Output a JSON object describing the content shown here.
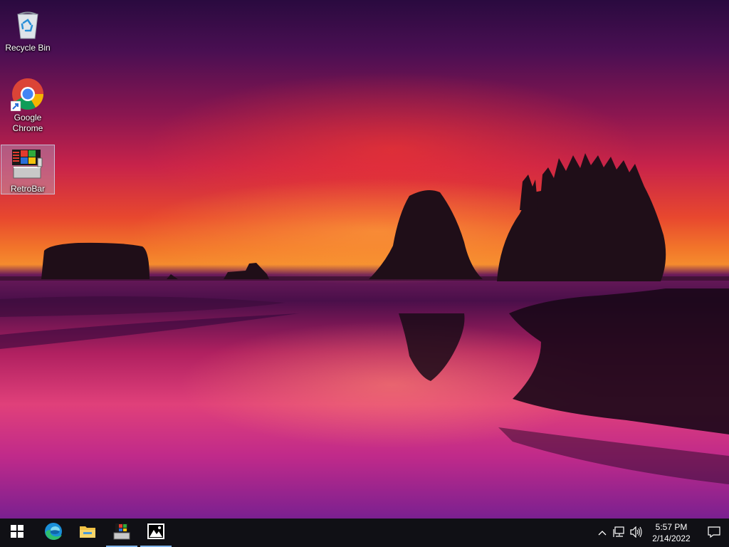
{
  "desktop": {
    "icons": [
      {
        "label": "Recycle Bin",
        "icon": "recycle-bin-icon"
      },
      {
        "label": "Google Chrome",
        "icon": "chrome-icon"
      },
      {
        "label": "RetroBar",
        "icon": "retrobar-icon",
        "selected": true
      }
    ]
  },
  "taskbar": {
    "buttons": [
      {
        "name": "start",
        "icon": "windows-logo-icon"
      },
      {
        "name": "edge",
        "icon": "edge-icon"
      },
      {
        "name": "file-explorer",
        "icon": "folder-icon"
      },
      {
        "name": "retrobar-app",
        "icon": "retrobar-icon",
        "running": true
      },
      {
        "name": "photos",
        "icon": "image-icon",
        "running": true
      }
    ],
    "tray": {
      "time": "5:57 PM",
      "date": "2/14/2022"
    }
  },
  "colors": {
    "taskbar_bg": "#101015",
    "running_indicator": "#7fb2e8",
    "selection": "#b4c8e6"
  }
}
